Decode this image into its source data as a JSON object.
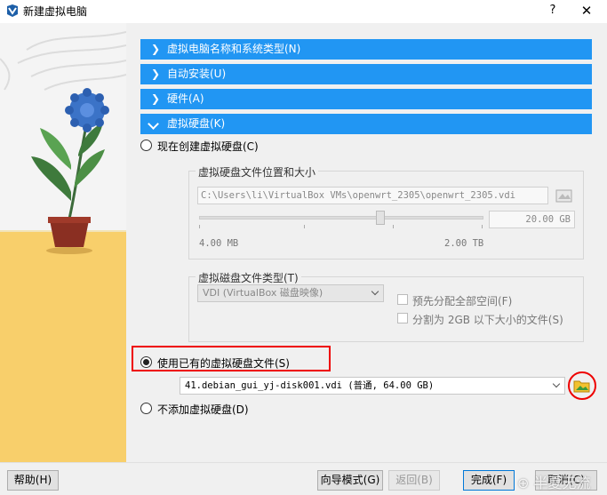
{
  "window": {
    "title": "新建虚拟电脑",
    "help_glyph": "?",
    "close_glyph": "✕"
  },
  "sections": [
    {
      "label": "虚拟电脑名称和系统类型(N)",
      "expanded": false
    },
    {
      "label": "自动安装(U)",
      "expanded": false
    },
    {
      "label": "硬件(A)",
      "expanded": false
    },
    {
      "label": "虚拟硬盘(K)",
      "expanded": true
    }
  ],
  "disk": {
    "create_new_label": "现在创建虚拟硬盘(C)",
    "location_group_title": "虚拟硬盘文件位置和大小",
    "path_value": "C:\\Users\\li\\VirtualBox VMs\\openwrt_2305\\openwrt_2305.vdi",
    "size_value": "20.00 GB",
    "slider_min": "4.00 MB",
    "slider_max": "2.00 TB",
    "type_group_title": "虚拟磁盘文件类型(T)",
    "type_value": "VDI (VirtualBox 磁盘映像)",
    "prealloc_label": "预先分配全部空间(F)",
    "split_label": "分割为 2GB 以下大小的文件(S)",
    "use_existing_label": "使用已有的虚拟硬盘文件(S)",
    "existing_value": "41.debian_gui_yj-disk001.vdi (普通, 64.00 GB)",
    "no_disk_label": "不添加虚拟硬盘(D)",
    "selected_option": "use_existing"
  },
  "buttons": {
    "help": "帮助(H)",
    "guided_mode": "向导模式(G)",
    "back": "返回(B)",
    "finish": "完成(F)",
    "cancel": "取消(C)"
  },
  "watermark": "⊕ 半夏无流",
  "colors": {
    "section_header": "#2196f3",
    "highlight_red": "#ee0000"
  }
}
